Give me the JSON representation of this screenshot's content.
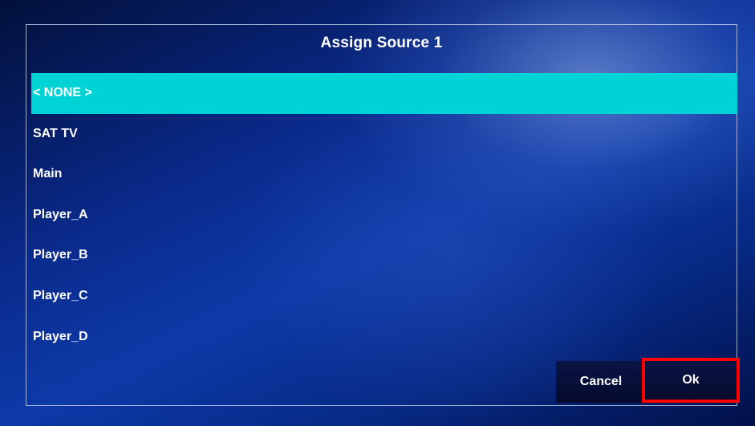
{
  "dialog": {
    "title": "Assign Source 1",
    "sources": [
      {
        "label": "< NONE >",
        "selected": true
      },
      {
        "label": "SAT TV",
        "selected": false
      },
      {
        "label": "Main",
        "selected": false
      },
      {
        "label": "Player_A",
        "selected": false
      },
      {
        "label": "Player_B",
        "selected": false
      },
      {
        "label": "Player_C",
        "selected": false
      },
      {
        "label": "Player_D",
        "selected": false
      }
    ],
    "cancel_label": "Cancel",
    "ok_label": "Ok"
  },
  "colors": {
    "selected_row": "#00d3d6",
    "highlight_border": "#ff0000",
    "button_bg": "#050b2e"
  }
}
